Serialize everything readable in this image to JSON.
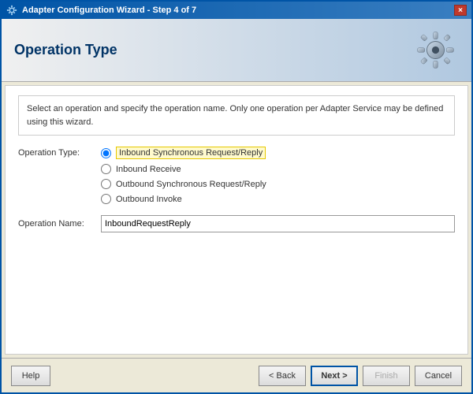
{
  "window": {
    "title": "Adapter Configuration Wizard - Step 4 of 7",
    "close_label": "×"
  },
  "header": {
    "title": "Operation Type"
  },
  "description": {
    "text": "Select an operation and specify the operation name. Only one operation per Adapter Service may be defined using this wizard."
  },
  "form": {
    "operation_type_label": "Operation Type:",
    "options": [
      {
        "value": "inbound_sync",
        "label": "Inbound Synchronous Request/Reply",
        "selected": true
      },
      {
        "value": "inbound_receive",
        "label": "Inbound Receive",
        "selected": false
      },
      {
        "value": "outbound_sync",
        "label": "Outbound Synchronous Request/Reply",
        "selected": false
      },
      {
        "value": "outbound_invoke",
        "label": "Outbound Invoke",
        "selected": false
      }
    ],
    "operation_name_label": "Operation Name:",
    "operation_name_value": "InboundRequestReply"
  },
  "footer": {
    "help_label": "Help",
    "back_label": "< Back",
    "next_label": "Next >",
    "finish_label": "Finish",
    "cancel_label": "Cancel"
  }
}
